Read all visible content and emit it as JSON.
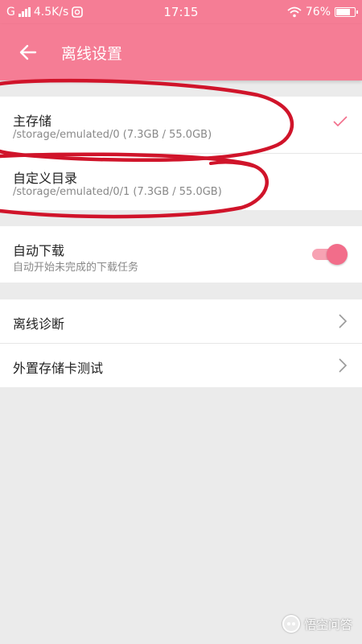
{
  "status_bar": {
    "carrier": "G",
    "net_speed": "4.5K/s",
    "time": "17:15",
    "battery": "76%",
    "battery_level": 0.76
  },
  "app_bar": {
    "title": "离线设置"
  },
  "storage": {
    "items": [
      {
        "title": "主存储",
        "path": "/storage/emulated/0 (7.3GB / 55.0GB)",
        "selected": true
      },
      {
        "title": "自定义目录",
        "path": "/storage/emulated/0/1 (7.3GB / 55.0GB)",
        "selected": false
      }
    ]
  },
  "auto_download": {
    "title": "自动下载",
    "subtitle": "自动开始未完成的下载任务",
    "enabled": true
  },
  "tools": {
    "items": [
      {
        "title": "离线诊断"
      },
      {
        "title": "外置存储卡测试"
      }
    ]
  },
  "watermark": {
    "text": "悟空问答"
  },
  "colors": {
    "accent": "#f57d95",
    "annotation": "#d0142a"
  }
}
